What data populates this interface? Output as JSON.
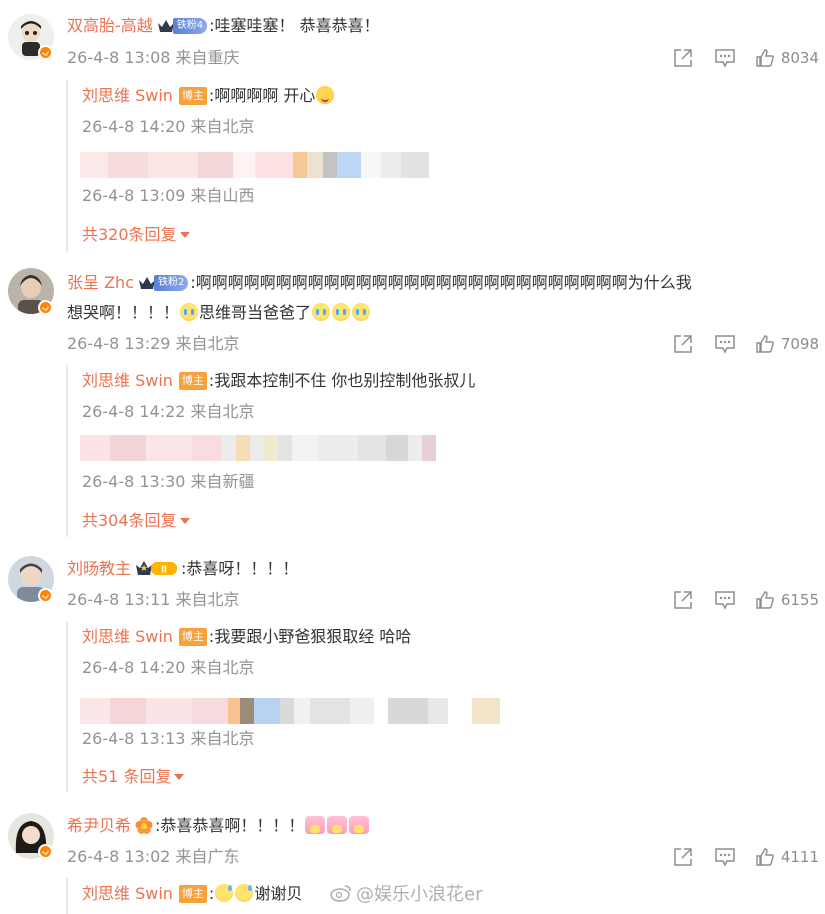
{
  "colors": {
    "username": "#eb7350",
    "meta_text": "#939393",
    "blogger_badge": "#f7a13b",
    "verified_badge": "#ff8200",
    "fan_badge": "#6b8de0"
  },
  "comments": [
    {
      "username": "双高胎-高越",
      "badge": {
        "type": "fan",
        "label": "铁粉4"
      },
      "text": ":哇塞哇塞！ 恭喜恭喜！",
      "meta": "26-4-8 13:08 来自重庆",
      "likes": "8034",
      "icons": [
        "share-icon",
        "comment-icon",
        "like-icon"
      ],
      "reply": {
        "username": "刘思维 Swin",
        "badge_label": "博主",
        "text": ":啊啊啊啊 开心",
        "emojis": [
          "happy-emoji"
        ],
        "meta": "26-4-8 14:20 来自北京"
      },
      "hidden_reply_meta": "26-4-8 13:09 来自山西",
      "more_replies": "共320条回复"
    },
    {
      "username": "张呈 Zhc",
      "badge": {
        "type": "fan",
        "label": "铁粉2"
      },
      "text_line1": ":啊啊啊啊啊啊啊啊啊啊啊啊啊啊啊啊啊啊啊啊啊啊啊啊啊啊啊为什么我",
      "text_line2": "想哭啊！！！！",
      "text_line2b": "思维哥当爸爸了",
      "meta": "26-4-8 13:29 来自北京",
      "likes": "7098",
      "reply": {
        "username": "刘思维 Swin",
        "badge_label": "博主",
        "text": ":我跟本控制不住 你也别控制他张叔儿",
        "meta": "26-4-8 14:22 来自北京"
      },
      "hidden_reply_meta": "26-4-8 13:30 来自新疆",
      "more_replies": "共304条回复"
    },
    {
      "username": "刘旸教主",
      "badge": {
        "type": "rank",
        "label": "II"
      },
      "text": ":恭喜呀！！！！",
      "meta": "26-4-8 13:11 来自北京",
      "likes": "6155",
      "reply": {
        "username": "刘思维 Swin",
        "badge_label": "博主",
        "text": ":我要跟小野爸狠狠取经 哈哈",
        "meta": "26-4-8 14:20 来自北京"
      },
      "hidden_reply_meta": "26-4-8 13:13 来自北京",
      "more_replies": "共51 条回复"
    },
    {
      "username": "希尹贝希",
      "badge": {
        "type": "flower"
      },
      "text": ":恭喜恭喜啊！！！！",
      "meta": "26-4-8 13:02 来自广东",
      "likes": "4111",
      "reply": {
        "username": "刘思维 Swin",
        "badge_label": "博主",
        "text_prefix": ":",
        "text": "谢谢贝"
      }
    }
  ],
  "watermark": "@娱乐小浪花er"
}
